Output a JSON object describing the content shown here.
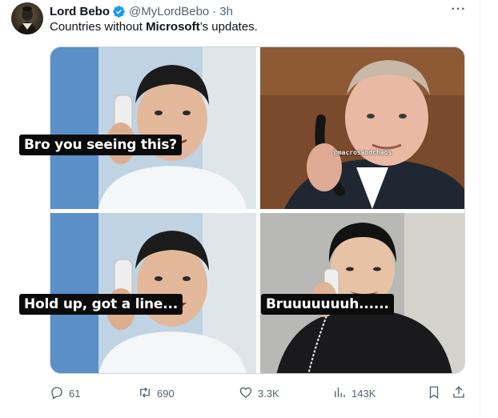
{
  "post": {
    "display_name": "Lord Bebo",
    "handle": "@MyLordBebo",
    "separator": "·",
    "time": "3h",
    "more_label": "···",
    "text_before": "Countries without ",
    "text_bold": "Microsoft",
    "text_after": "’s updates."
  },
  "media": {
    "captions": [
      "Bro you seeing this?",
      "Hold up, got a line...",
      "Bruuuuuuuh......"
    ],
    "watermark": "@macrosandchaos"
  },
  "actions": {
    "replies": "61",
    "reposts": "690",
    "likes": "3.3K",
    "views": "143K"
  },
  "colors": {
    "verified": "#1d9bf0",
    "muted": "#536471",
    "text": "#0f1419"
  },
  "icons": [
    "verified-badge-icon",
    "more-icon",
    "reply-icon",
    "repost-icon",
    "like-icon",
    "views-icon",
    "bookmark-icon",
    "share-icon"
  ]
}
